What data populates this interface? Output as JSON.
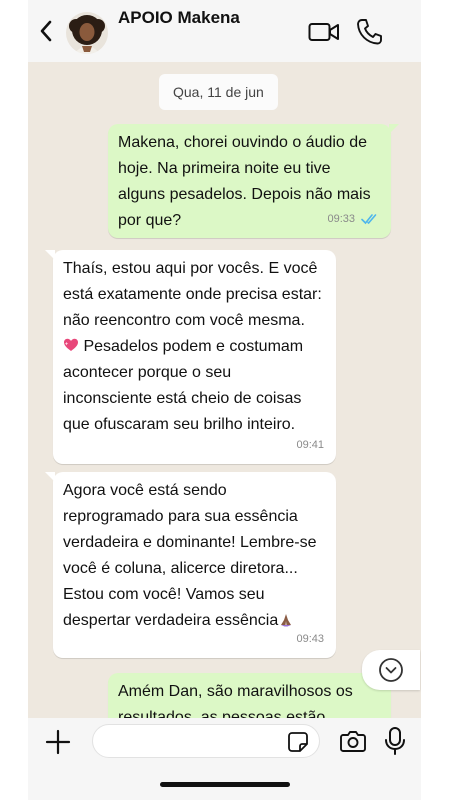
{
  "header": {
    "title": "APOIO Makena"
  },
  "chat": {
    "date_chip": "Qua, 11 de jun",
    "messages": [
      {
        "direction": "outgoing",
        "text": "Makena, chorei ouvindo o áudio de\nhoje. Na primeira noite eu tive\nalguns pesadelos. Depois não mais\npor que?",
        "time": "09:33",
        "status": "read"
      },
      {
        "direction": "incoming",
        "text_a": "Thaís, estou aqui por vocês. E você\nestá exatamente onde precisa estar:\nnão reencontro com você mesma.",
        "emoji_a": "sparkling-heart",
        "text_b": " Pesadelos podem e costumam\nacontecer porque o seu\ninconsciente está cheio de coisas\nque ofuscaram seu brilho inteiro.",
        "time": "09:41"
      },
      {
        "direction": "incoming",
        "text": "Agora você está sendo\nreprogramado para sua essência\nverdadeira e dominante! Lembre-se\nvocê é coluna, alicerce diretora...\nEstou com você! Vamos seu\ndespertar verdadeira essência",
        "emoji": "praying-hands",
        "time": "09:43"
      },
      {
        "direction": "outgoing",
        "text": "Amém Dan, são maravilhosos os\nresultados, as pessoas estão"
      }
    ]
  },
  "composer": {
    "placeholder": ""
  },
  "colors": {
    "outgoing_bubble": "#dcf8c6",
    "incoming_bubble": "#ffffff",
    "chat_background": "#eee8df",
    "read_ticks": "#4fb6ec"
  }
}
